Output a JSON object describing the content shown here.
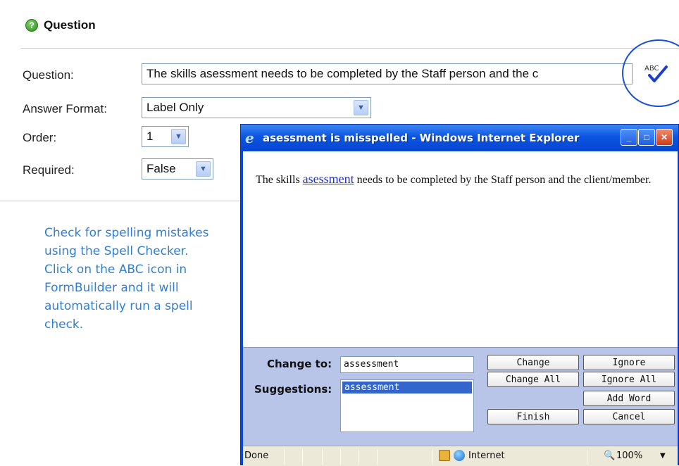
{
  "form": {
    "section_title": "Question",
    "fields": {
      "question_label": "Question:",
      "question_value": "The skills asessment needs to be completed by the Staff person and the c",
      "answer_format_label": "Answer Format:",
      "answer_format_value": "Label Only",
      "order_label": "Order:",
      "order_value": "1",
      "required_label": "Required:",
      "required_value": "False"
    },
    "spellcheck_icon_text": "ABC"
  },
  "instructions": "Check for spelling mistakes using the Spell Checker.  Click on the ABC icon in FormBuilder and it will automatically run a spell check.",
  "ie_window": {
    "title": "asessment is misspelled - Windows Internet Explorer",
    "content": {
      "before": "The skills ",
      "misspelled": "asessment",
      "after": " needs to be completed by the Staff person and the client/member."
    },
    "change_to_label": "Change to:",
    "change_to_value": "assessment",
    "suggestions_label": "Suggestions:",
    "suggestions": [
      "assessment"
    ],
    "buttons": {
      "change": "Change",
      "ignore": "Ignore",
      "change_all": "Change All",
      "ignore_all": "Ignore All",
      "add_word": "Add Word",
      "finish": "Finish",
      "cancel": "Cancel"
    },
    "status": {
      "left": "Done",
      "zone": "Internet",
      "zoom": "100%"
    }
  },
  "colors": {
    "instruction_text": "#2f7fd6",
    "titlebar": "#0b55e2",
    "highlight_circle": "#1a4fd6"
  }
}
